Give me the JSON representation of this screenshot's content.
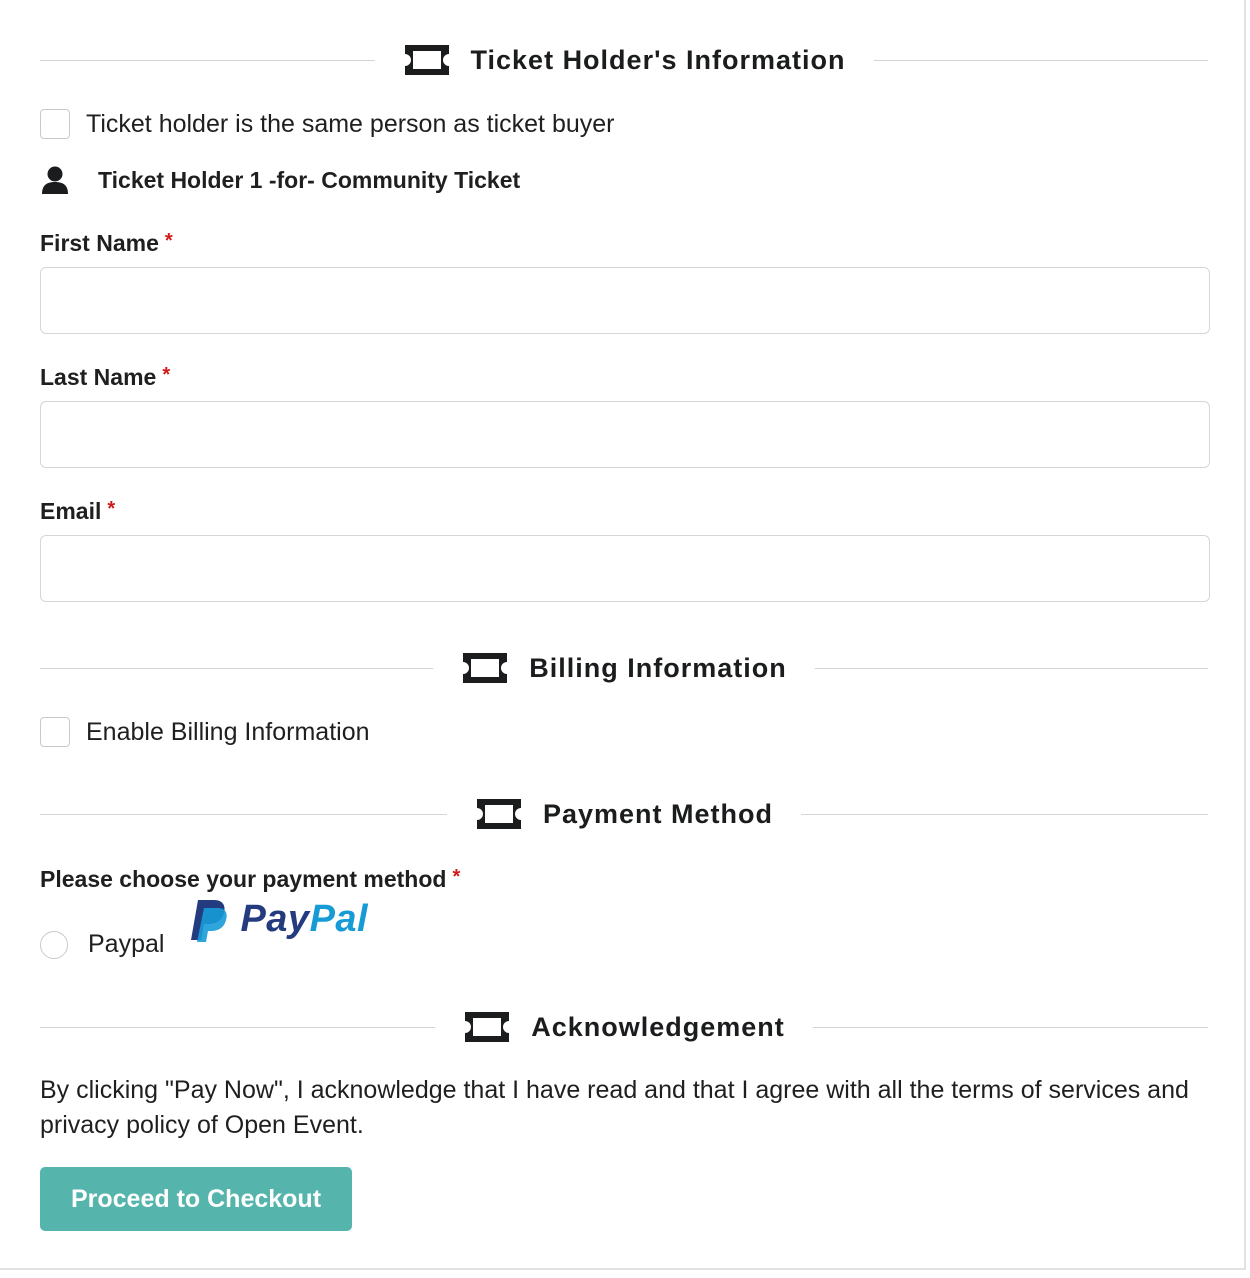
{
  "sections": {
    "holder_info": {
      "title": "Ticket Holder's Information",
      "icon": "ticket-icon"
    },
    "billing": {
      "title": "Billing Information",
      "icon": "ticket-icon"
    },
    "payment": {
      "title": "Payment Method",
      "icon": "ticket-icon"
    },
    "acknowledgement": {
      "title": "Acknowledgement",
      "icon": "ticket-icon"
    }
  },
  "holder_same_checkbox": {
    "label": "Ticket holder is the same person as ticket buyer",
    "checked": false
  },
  "holder": {
    "icon": "user-icon",
    "title": "Ticket Holder 1 -for- Community Ticket"
  },
  "fields": {
    "first_name": {
      "label": "First Name",
      "value": "",
      "required_mark": "*"
    },
    "last_name": {
      "label": "Last Name",
      "value": "",
      "required_mark": "*"
    },
    "email": {
      "label": "Email",
      "value": "",
      "required_mark": "*"
    }
  },
  "billing_checkbox": {
    "label": "Enable Billing Information",
    "checked": false
  },
  "payment": {
    "prompt": "Please choose your payment method",
    "required_mark": "*",
    "option_label": "Paypal",
    "selected": false,
    "logo": {
      "pay": "Pay",
      "pal": "Pal",
      "colors": {
        "pay": "#253b80",
        "pal": "#179bd7"
      }
    }
  },
  "acknowledgement_text": "By clicking \"Pay Now\", I acknowledge that I have read and that I agree with all the terms of services and privacy policy of Open Event.",
  "checkout_button": {
    "label": "Proceed to Checkout",
    "color": "#55b5ad"
  }
}
